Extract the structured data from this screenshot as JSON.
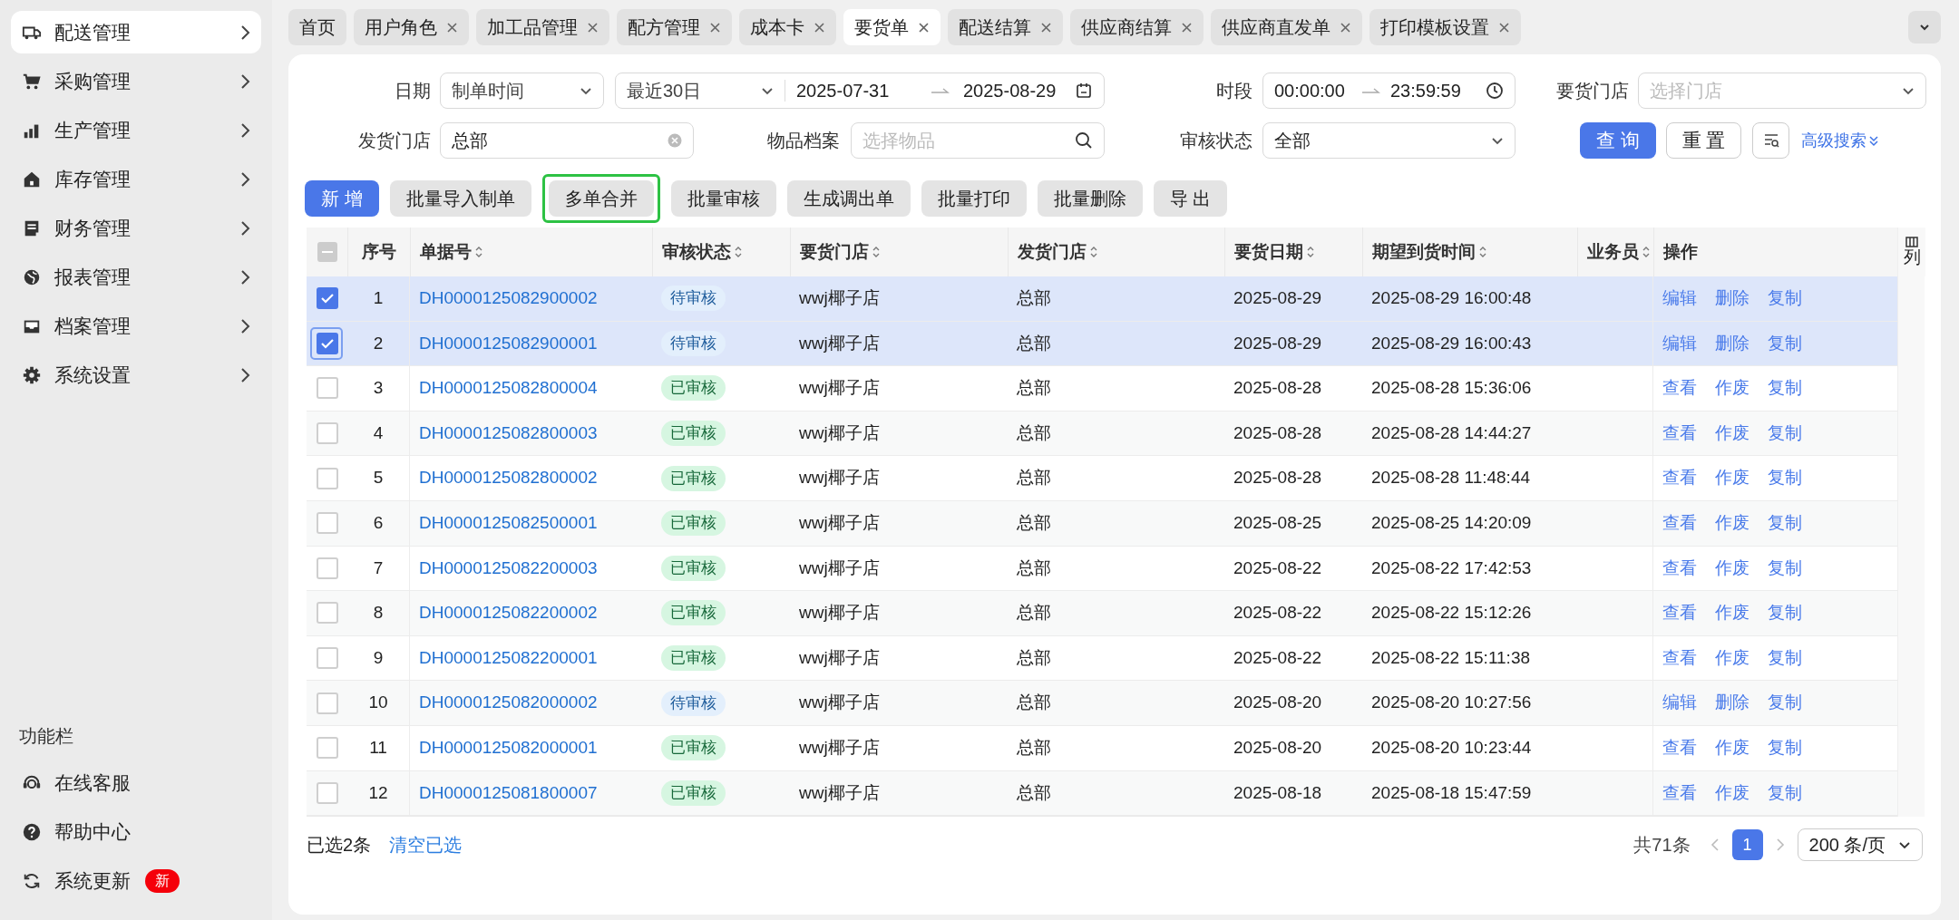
{
  "sidebar": {
    "menu": [
      {
        "label": "配送管理",
        "selected": true
      },
      {
        "label": "采购管理",
        "selected": false
      },
      {
        "label": "生产管理",
        "selected": false
      },
      {
        "label": "库存管理",
        "selected": false
      },
      {
        "label": "财务管理",
        "selected": false
      },
      {
        "label": "报表管理",
        "selected": false
      },
      {
        "label": "档案管理",
        "selected": false
      },
      {
        "label": "系统设置",
        "selected": false
      }
    ],
    "tools_title": "功能栏",
    "tools": [
      {
        "label": "在线客服"
      },
      {
        "label": "帮助中心"
      },
      {
        "label": "系统更新",
        "badge": "新"
      }
    ]
  },
  "tabs": [
    {
      "label": "首页",
      "closable": false,
      "selected": false
    },
    {
      "label": "用户角色",
      "closable": true,
      "selected": false
    },
    {
      "label": "加工品管理",
      "closable": true,
      "selected": false
    },
    {
      "label": "配方管理",
      "closable": true,
      "selected": false
    },
    {
      "label": "成本卡",
      "closable": true,
      "selected": false
    },
    {
      "label": "要货单",
      "closable": true,
      "selected": true
    },
    {
      "label": "配送结算",
      "closable": true,
      "selected": false
    },
    {
      "label": "供应商结算",
      "closable": true,
      "selected": false
    },
    {
      "label": "供应商直发单",
      "closable": true,
      "selected": false
    },
    {
      "label": "打印模板设置",
      "closable": true,
      "selected": false
    }
  ],
  "filters": {
    "date_label": "日期",
    "date_type": "制单时间",
    "date_preset": "最近30日",
    "date_start": "2025-07-31",
    "date_end": "2025-08-29",
    "time_label": "时段",
    "time_start": "00:00:00",
    "time_end": "23:59:59",
    "request_store_label": "要货门店",
    "request_store_placeholder": "选择门店",
    "ship_store_label": "发货门店",
    "ship_store_value": "总部",
    "item_label": "物品档案",
    "item_placeholder": "选择物品",
    "status_label": "审核状态",
    "status_value": "全部",
    "query": "查 询",
    "reset": "重 置",
    "advanced": "高级搜索"
  },
  "toolbar": [
    {
      "label": "新 增",
      "kind": "primary",
      "highlighted": false
    },
    {
      "label": "批量导入制单",
      "kind": "normal",
      "highlighted": false
    },
    {
      "label": "多单合并",
      "kind": "normal",
      "highlighted": true
    },
    {
      "label": "批量审核",
      "kind": "normal",
      "highlighted": false
    },
    {
      "label": "生成调出单",
      "kind": "normal",
      "highlighted": false
    },
    {
      "label": "批量打印",
      "kind": "normal",
      "highlighted": false
    },
    {
      "label": "批量删除",
      "kind": "normal",
      "highlighted": false
    },
    {
      "label": "导 出",
      "kind": "normal",
      "highlighted": false
    }
  ],
  "table": {
    "select_all_indeterminate": true,
    "columns": [
      {
        "label": "序号",
        "sortable": false
      },
      {
        "label": "单据号",
        "sortable": true
      },
      {
        "label": "审核状态",
        "sortable": true
      },
      {
        "label": "要货门店",
        "sortable": true
      },
      {
        "label": "发货门店",
        "sortable": true
      },
      {
        "label": "要货日期",
        "sortable": true
      },
      {
        "label": "期望到货时间",
        "sortable": true
      },
      {
        "label": "业务员",
        "sortable": true
      },
      {
        "label": "操作",
        "sortable": false
      }
    ],
    "column_setting": "列",
    "rows": [
      {
        "no": "1",
        "checked": true,
        "focused": false,
        "order": "DH0000125082900002",
        "status": "待审核",
        "kind": "pending",
        "store": "wwj椰子店",
        "ship": "总部",
        "date": "2025-08-29",
        "expected": "2025-08-29 16:00:48",
        "actions": [
          "编辑",
          "删除",
          "复制"
        ]
      },
      {
        "no": "2",
        "checked": true,
        "focused": true,
        "order": "DH0000125082900001",
        "status": "待审核",
        "kind": "pending",
        "store": "wwj椰子店",
        "ship": "总部",
        "date": "2025-08-29",
        "expected": "2025-08-29 16:00:43",
        "actions": [
          "编辑",
          "删除",
          "复制"
        ]
      },
      {
        "no": "3",
        "checked": false,
        "focused": false,
        "order": "DH0000125082800004",
        "status": "已审核",
        "kind": "approved",
        "store": "wwj椰子店",
        "ship": "总部",
        "date": "2025-08-28",
        "expected": "2025-08-28 15:36:06",
        "actions": [
          "查看",
          "作废",
          "复制"
        ]
      },
      {
        "no": "4",
        "checked": false,
        "focused": false,
        "order": "DH0000125082800003",
        "status": "已审核",
        "kind": "approved",
        "store": "wwj椰子店",
        "ship": "总部",
        "date": "2025-08-28",
        "expected": "2025-08-28 14:44:27",
        "actions": [
          "查看",
          "作废",
          "复制"
        ]
      },
      {
        "no": "5",
        "checked": false,
        "focused": false,
        "order": "DH0000125082800002",
        "status": "已审核",
        "kind": "approved",
        "store": "wwj椰子店",
        "ship": "总部",
        "date": "2025-08-28",
        "expected": "2025-08-28 11:48:44",
        "actions": [
          "查看",
          "作废",
          "复制"
        ]
      },
      {
        "no": "6",
        "checked": false,
        "focused": false,
        "order": "DH0000125082500001",
        "status": "已审核",
        "kind": "approved",
        "store": "wwj椰子店",
        "ship": "总部",
        "date": "2025-08-25",
        "expected": "2025-08-25 14:20:09",
        "actions": [
          "查看",
          "作废",
          "复制"
        ]
      },
      {
        "no": "7",
        "checked": false,
        "focused": false,
        "order": "DH0000125082200003",
        "status": "已审核",
        "kind": "approved",
        "store": "wwj椰子店",
        "ship": "总部",
        "date": "2025-08-22",
        "expected": "2025-08-22 17:42:53",
        "actions": [
          "查看",
          "作废",
          "复制"
        ]
      },
      {
        "no": "8",
        "checked": false,
        "focused": false,
        "order": "DH0000125082200002",
        "status": "已审核",
        "kind": "approved",
        "store": "wwj椰子店",
        "ship": "总部",
        "date": "2025-08-22",
        "expected": "2025-08-22 15:12:26",
        "actions": [
          "查看",
          "作废",
          "复制"
        ]
      },
      {
        "no": "9",
        "checked": false,
        "focused": false,
        "order": "DH0000125082200001",
        "status": "已审核",
        "kind": "approved",
        "store": "wwj椰子店",
        "ship": "总部",
        "date": "2025-08-22",
        "expected": "2025-08-22 15:11:38",
        "actions": [
          "查看",
          "作废",
          "复制"
        ]
      },
      {
        "no": "10",
        "checked": false,
        "focused": false,
        "order": "DH0000125082000002",
        "status": "待审核",
        "kind": "pending",
        "store": "wwj椰子店",
        "ship": "总部",
        "date": "2025-08-20",
        "expected": "2025-08-20 10:27:56",
        "actions": [
          "编辑",
          "删除",
          "复制"
        ]
      },
      {
        "no": "11",
        "checked": false,
        "focused": false,
        "order": "DH0000125082000001",
        "status": "已审核",
        "kind": "approved",
        "store": "wwj椰子店",
        "ship": "总部",
        "date": "2025-08-20",
        "expected": "2025-08-20 10:23:44",
        "actions": [
          "查看",
          "作废",
          "复制"
        ]
      },
      {
        "no": "12",
        "checked": false,
        "focused": false,
        "order": "DH0000125081800007",
        "status": "已审核",
        "kind": "approved",
        "store": "wwj椰子店",
        "ship": "总部",
        "date": "2025-08-18",
        "expected": "2025-08-18 15:47:59",
        "actions": [
          "查看",
          "作废",
          "复制"
        ]
      }
    ]
  },
  "footer": {
    "selected_count": "已选2条",
    "clear": "清空已选",
    "total": "共71条",
    "current_page": "1",
    "page_size": "200 条/页"
  }
}
